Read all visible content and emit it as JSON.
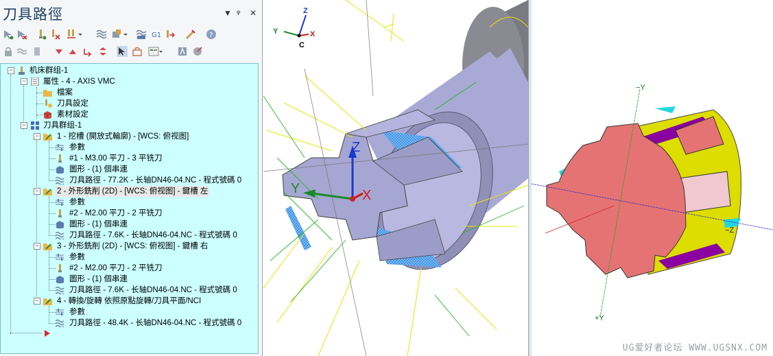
{
  "panel": {
    "title": "刀具路徑",
    "controls": {
      "dropdown": "▼",
      "pin": "ᵠ",
      "close": "✕"
    }
  },
  "tree": {
    "machine_group": "机床群组-1",
    "properties": "屬性 - 4 - AXIS VMC",
    "files": "檔案",
    "tool_settings": "刀具設定",
    "stock_settings": "素材設定",
    "toolpath_group": "刀具群组-1",
    "operations": [
      {
        "label": "1 - 挖槽 (開放式輪廓) - [WCS: 俯视图]",
        "params": "参數",
        "tool": "#1 - M3.00 平刀 - 3 平铣刀",
        "geometry": "圖形 - (1) 個串連",
        "toolpath": "刀具路徑 - 77.2K - 长轴DN46-04.NC - 程式號碼 0"
      },
      {
        "label": "2 - 外形銑削 (2D) - [WCS: 俯视图] - 鍵槽 左",
        "params": "参數",
        "tool": "#2 - M2.00 平刀 - 2 平铣刀",
        "geometry": "圖形 - (1) 個串連",
        "toolpath": "刀具路徑 - 7.6K - 长轴DN46-04.NC - 程式號碼 0"
      },
      {
        "label": "3 - 外形銑削 (2D) - [WCS: 俯视图] - 鍵槽 右",
        "params": "参數",
        "tool": "#2 - M2.00 平刀 - 2 平铣刀",
        "geometry": "圖形 - (1) 個串連",
        "toolpath": "刀具路徑 - 7.6K - 长轴DN46-04.NC - 程式號碼 0"
      },
      {
        "label": "4 - 轉換/旋轉 依照原點旋轉/刀具平面/NCI",
        "params": "参數",
        "toolpath": "刀具路徑 - 48.4K - 长轴DN46-04.NC - 程式號碼 0"
      }
    ]
  },
  "view1": {
    "gnomon": {
      "z": "Z",
      "y": "Y",
      "x": "X",
      "c": "C"
    },
    "axes": {
      "z": "Z",
      "y": "Y",
      "x": "X"
    }
  },
  "view2": {
    "axis_top": "−Y",
    "axis_bottom": "+Y",
    "axis_right": "−Z"
  },
  "watermark": "UG爱好者论坛 WWW.UGSNX.COM",
  "colors": {
    "tree_bg": "#ccffff",
    "part_face": "#e57373",
    "part_side": "#dddd00",
    "shaft": "#a9a9d6"
  }
}
